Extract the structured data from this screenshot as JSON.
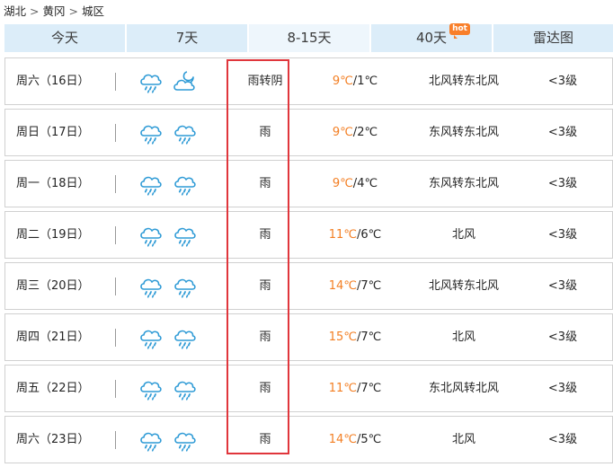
{
  "breadcrumb": {
    "province": "湖北",
    "city": "黄冈",
    "district": "城区",
    "sep": ">"
  },
  "tabs": [
    {
      "label": "今天"
    },
    {
      "label": "7天"
    },
    {
      "label": "8-15天",
      "active": true
    },
    {
      "label": "40天",
      "badge": "hot"
    },
    {
      "label": "雷达图"
    }
  ],
  "colors": {
    "tab_bg": "#dcedf9",
    "tab_active_bg": "#eef6fc",
    "high_temp": "#f37e22",
    "highlight_border": "#e0363c",
    "hot_badge": "#f97f2a",
    "icon_stroke": "#2f9bd6"
  },
  "days": [
    {
      "date": "周六（16日）",
      "icon_day": "rain-icon",
      "icon_night": "cloudy-night-icon",
      "condition": "雨转阴",
      "temp_high": "9℃",
      "temp_sep": "/",
      "temp_low": "1℃",
      "wind": "北风转东北风",
      "level": "<3级"
    },
    {
      "date": "周日（17日）",
      "icon_day": "rain-icon",
      "icon_night": "rain-icon",
      "condition": "雨",
      "temp_high": "9℃",
      "temp_sep": "/",
      "temp_low": "2℃",
      "wind": "东风转东北风",
      "level": "<3级"
    },
    {
      "date": "周一（18日）",
      "icon_day": "rain-icon",
      "icon_night": "rain-icon",
      "condition": "雨",
      "temp_high": "9℃",
      "temp_sep": "/",
      "temp_low": "4℃",
      "wind": "东风转东北风",
      "level": "<3级"
    },
    {
      "date": "周二（19日）",
      "icon_day": "rain-icon",
      "icon_night": "rain-icon",
      "condition": "雨",
      "temp_high": "11℃",
      "temp_sep": "/",
      "temp_low": "6℃",
      "wind": "北风",
      "level": "<3级"
    },
    {
      "date": "周三（20日）",
      "icon_day": "rain-icon",
      "icon_night": "rain-icon",
      "condition": "雨",
      "temp_high": "14℃",
      "temp_sep": "/",
      "temp_low": "7℃",
      "wind": "北风转东北风",
      "level": "<3级"
    },
    {
      "date": "周四（21日）",
      "icon_day": "rain-icon",
      "icon_night": "rain-icon",
      "condition": "雨",
      "temp_high": "15℃",
      "temp_sep": "/",
      "temp_low": "7℃",
      "wind": "北风",
      "level": "<3级"
    },
    {
      "date": "周五（22日）",
      "icon_day": "rain-icon",
      "icon_night": "rain-icon",
      "condition": "雨",
      "temp_high": "11℃",
      "temp_sep": "/",
      "temp_low": "7℃",
      "wind": "东北风转北风",
      "level": "<3级"
    },
    {
      "date": "周六（23日）",
      "icon_day": "rain-icon",
      "icon_night": "rain-icon",
      "condition": "雨",
      "temp_high": "14℃",
      "temp_sep": "/",
      "temp_low": "5℃",
      "wind": "北风",
      "level": "<3级"
    }
  ]
}
